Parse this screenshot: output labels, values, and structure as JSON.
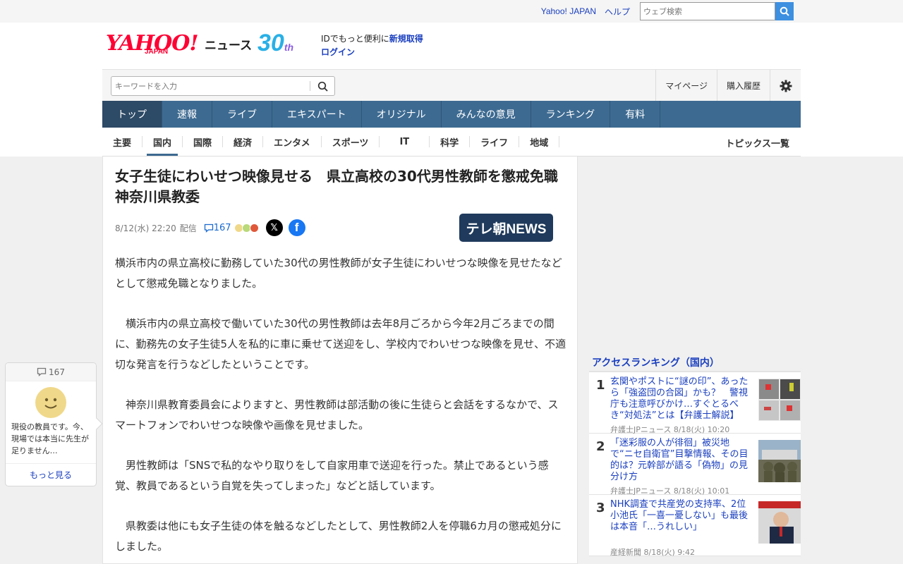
{
  "topbar": {
    "yahoo_japan": "Yahoo! JAPAN",
    "help": "ヘルプ",
    "search_placeholder": "ウェブ検索"
  },
  "logo": {
    "main": "YAHOO!",
    "sub": "JAPAN",
    "news": "ニュース",
    "anniv": "30",
    "anniv_suffix": "th"
  },
  "id": {
    "text": "IDでもっと便利に",
    "register": "新規取得",
    "login": "ログイン"
  },
  "search": {
    "placeholder": "キーワードを入力"
  },
  "header_links": {
    "mypage": "マイページ",
    "purchase": "購入履歴"
  },
  "gnav": [
    "トップ",
    "速報",
    "ライブ",
    "エキスパート",
    "オリジナル",
    "みんなの意見",
    "ランキング",
    "有料"
  ],
  "subnav": {
    "items": [
      "主要",
      "国内",
      "国際",
      "経済",
      "エンタメ",
      "スポーツ",
      "IT",
      "科学",
      "ライフ",
      "地域"
    ],
    "topics": "トピックス一覧"
  },
  "article": {
    "title": "女子生徒にわいせつ映像見せる　県立高校の30代男性教師を懲戒免職　神奈川県教委",
    "date": "8/12(水) 22:20",
    "delivered": "配信",
    "comment_count": "167",
    "provider": "テレ朝NEWS",
    "paragraphs": [
      "横浜市内の県立高校に勤務していた30代の男性教師が女子生徒にわいせつな映像を見せたなどとして懲戒免職となりました。",
      "　横浜市内の県立高校で働いていた30代の男性教師は去年8月ごろから今年2月ごろまでの間に、勤務先の女子生徒5人を私的に車に乗せて送迎をし、学校内でわいせつな映像を見せ、不適切な発言を行うなどしたということです。",
      "　神奈川県教育委員会によりますと、男性教師は部活動の後に生徒らと会話をするなかで、スマートフォンでわいせつな映像や画像を見せました。",
      "　男性教師は「SNSで私的なやり取りをして自家用車で送迎を行った。禁止であるという感覚、教員であるという自覚を失ってしまった」などと話しています。",
      "　県教委は他にも女子生徒の体を触るなどしたとして、男性教師2人を停職6カ月の懲戒処分にしました。"
    ]
  },
  "ranking": {
    "heading": "アクセスランキング（国内）",
    "items": [
      {
        "rank": "1",
        "title": "玄関やポストに“謎の印”、あったら「強盗団の合図」かも？　警視庁も注意呼びかけ…すぐとるべき“対処法”とは【弁護士解説】",
        "source": "弁護士JPニュース",
        "date": "8/18(火) 10:20"
      },
      {
        "rank": "2",
        "title": "「迷彩服の人が徘徊」被災地で“ニセ自衛官”目撃情報、その目的は？元幹部が語る「偽物」の見分け方",
        "source": "弁護士JPニュース",
        "date": "8/18(火) 10:01"
      },
      {
        "rank": "3",
        "title": "NHK調査で共産党の支持率、2位小池氏「一喜一憂しない」も最後は本音「…うれしい」",
        "source": "産経新聞",
        "date": "8/18(火) 9:42"
      }
    ]
  },
  "comment_widget": {
    "count": "167",
    "snippet": "現役の教員です。今、現場では本当に先生が足りません…",
    "more": "もっと見る"
  },
  "colors": {
    "brand_red": "#ff0033",
    "nav_blue": "#3d6a91",
    "link_blue": "#1a3fbf"
  }
}
